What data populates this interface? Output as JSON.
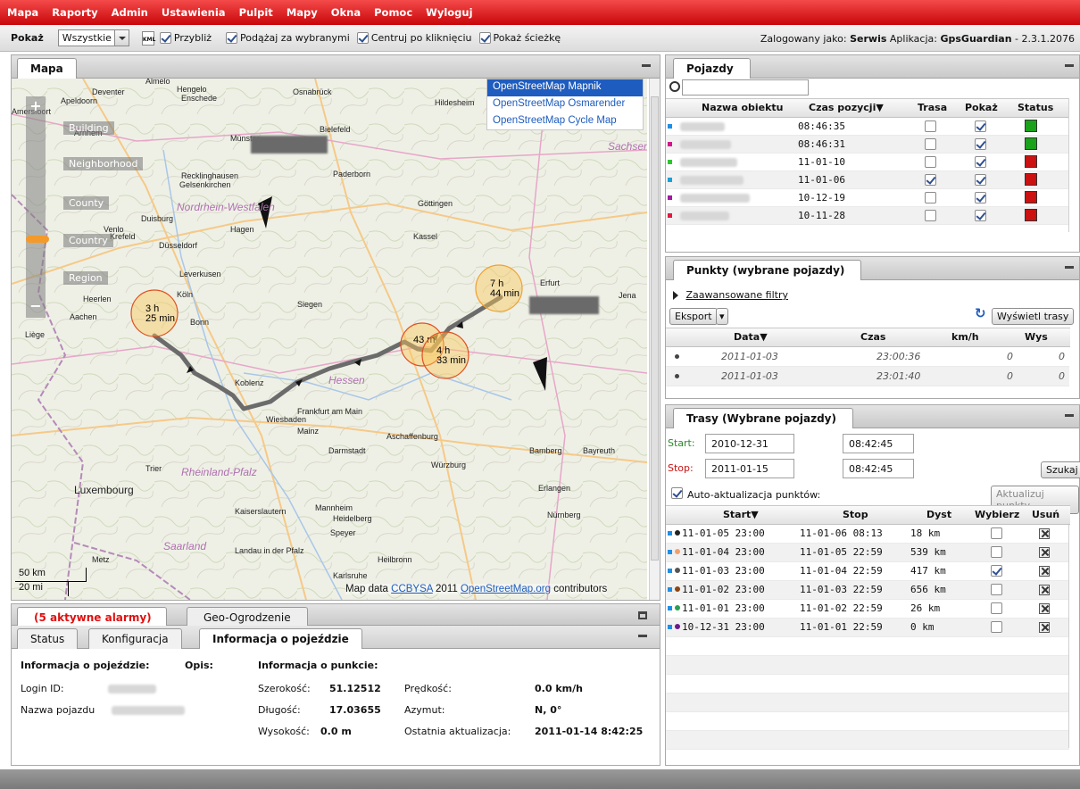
{
  "menu": [
    "Mapa",
    "Raporty",
    "Admin",
    "Ustawienia",
    "Pulpit",
    "Mapy",
    "Okna",
    "Pomoc",
    "Wyloguj"
  ],
  "toolbar": {
    "show_label": "Pokaż",
    "show_value": "Wszystkie",
    "kml_label": "KML",
    "zoom_label": "Przybliż",
    "follow_label": "Podążaj za wybranymi",
    "center_label": "Centruj po kliknięciu",
    "path_label": "Pokaż ścieżkę",
    "logged_prefix": "Zalogowany jako:",
    "user": "Serwis",
    "app_prefix": "Aplikacja:",
    "app": "GpsGuardian",
    "version": "- 2.3.1.2076"
  },
  "map": {
    "tab": "Mapa",
    "layers": [
      "OpenStreetMap Mapnik",
      "OpenStreetMap Osmarender",
      "OpenStreetMap Cycle Map"
    ],
    "zoom_labels": [
      "Building",
      "Neighborhood",
      "County",
      "Country",
      "Region"
    ],
    "scale_km": "50 km",
    "scale_mi": "20 mi",
    "attr_prefix": "Map data",
    "attr_link1": "CCBYSA",
    "attr_year": "2011",
    "attr_link2": "OpenStreetMap.org",
    "attr_suffix": "contributors",
    "cities": [
      "Almelo",
      "Deventer",
      "Hengelo",
      "Apeldoorn",
      "Enschede",
      "Osnabrück",
      "Amersfoort",
      "Arnhem",
      "Bielefeld",
      "Hildesheim",
      "Sachsen",
      "Münster",
      "Paderborn",
      "Recklinghausen",
      "Gelsenkirchen",
      "Nordrhein-Westfalen",
      "Göttingen",
      "Duisburg",
      "Hagen",
      "Venlo",
      "Krefeld",
      "Düsseldorf",
      "Kassel",
      "Leverkusen",
      "Köln",
      "Erfurt",
      "Jena",
      "Heerlen",
      "Aachen",
      "Siegen",
      "Bonn",
      "Liège",
      "Koblenz",
      "Hessen",
      "Frankfurt am Main",
      "Wiesbaden",
      "Mainz",
      "Aschaffenburg",
      "Darmstadt",
      "Bamberg",
      "Bayreuth",
      "Trier",
      "Rheinland-Pfalz",
      "Würzburg",
      "Luxembourg",
      "Erlangen",
      "Kaiserslautern",
      "Mannheim",
      "Heidelberg",
      "Nürnberg",
      "Speyer",
      "Saarland",
      "Landau in der Pfalz",
      "Metz",
      "Heilbronn",
      "Karlsruhe"
    ],
    "stops": [
      {
        "line1": "3 h",
        "line2": "25 min"
      },
      {
        "line1": "7 h",
        "line2": "44 min"
      },
      {
        "line1": "43 m",
        "line2": ""
      },
      {
        "line1": "4 h",
        "line2": "33 min"
      }
    ]
  },
  "vehicles": {
    "tab": "Pojazdy",
    "columns": [
      "Nazwa obiektu",
      "Czas pozycji▼",
      "Trasa",
      "Pokaż",
      "Status"
    ],
    "rows": [
      {
        "color": "#1e8fe6",
        "time": "08:46:35",
        "trasa": false,
        "show": true,
        "status": "#1aa21a"
      },
      {
        "color": "#d4148a",
        "time": "08:46:31",
        "trasa": false,
        "show": true,
        "status": "#1aa21a"
      },
      {
        "color": "#2ec52e",
        "time": "11-01-10",
        "trasa": false,
        "show": true,
        "status": "#cc1111"
      },
      {
        "color": "#1aa0d8",
        "time": "11-01-06",
        "trasa": true,
        "show": true,
        "status": "#cc1111"
      },
      {
        "color": "#a01aa0",
        "time": "10-12-19",
        "trasa": false,
        "show": true,
        "status": "#cc1111"
      },
      {
        "color": "#e01a40",
        "time": "10-11-28",
        "trasa": false,
        "show": true,
        "status": "#cc1111"
      }
    ]
  },
  "points": {
    "tab": "Punkty (wybrane pojazdy)",
    "filters": "Zaawansowane filtry",
    "export": "Eksport",
    "show_routes": "Wyświetl trasy",
    "columns": [
      "Data▼",
      "Czas",
      "km/h",
      "Wys"
    ],
    "rows": [
      {
        "date": "2011-01-03",
        "time": "23:00:36",
        "speed": "0",
        "alt": "0"
      },
      {
        "date": "2011-01-03",
        "time": "23:01:40",
        "speed": "0",
        "alt": "0"
      }
    ]
  },
  "routes": {
    "tab": "Trasy (Wybrane pojazdy)",
    "start_label": "Start:",
    "start_date": "2010-12-31",
    "start_time": "08:42:45",
    "stop_label": "Stop:",
    "stop_date": "2011-01-15",
    "stop_time": "08:42:45",
    "search": "Szukaj",
    "auto_label": "Auto-aktualizacja punktów:",
    "update": "Aktualizuj punkty",
    "columns": [
      "Start▼",
      "Stop",
      "Dyst",
      "Wybierz",
      "Usuń"
    ],
    "rows": [
      {
        "dot": "#222222",
        "start": "11-01-05 23:00",
        "stop": "11-01-06 08:13",
        "dist": "18 km",
        "sel": false
      },
      {
        "dot": "#f0a070",
        "start": "11-01-04 23:00",
        "stop": "11-01-05 22:59",
        "dist": "539 km",
        "sel": false
      },
      {
        "dot": "#555555",
        "start": "11-01-03 23:00",
        "stop": "11-01-04 22:59",
        "dist": "417 km",
        "sel": true
      },
      {
        "dot": "#8b4513",
        "start": "11-01-02 23:00",
        "stop": "11-01-03 22:59",
        "dist": "656 km",
        "sel": false
      },
      {
        "dot": "#2aa050",
        "start": "11-01-01 23:00",
        "stop": "11-01-02 22:59",
        "dist": "26 km",
        "sel": false
      },
      {
        "dot": "#6a1a8a",
        "start": "10-12-31 23:00",
        "stop": "11-01-01 22:59",
        "dist": "0 km",
        "sel": false
      }
    ]
  },
  "bottom": {
    "tab_alarms": "(5 aktywne alarmy)",
    "tab_geo": "Geo-Ogrodzenie",
    "tab_status": "Status",
    "tab_config": "Konfiguracja",
    "tab_info": "Informacja o pojeździe",
    "h_vehicle": "Informacja o pojeździe:",
    "h_desc": "Opis:",
    "h_point": "Informacja o punkcie:",
    "login_label": "Login ID:",
    "name_label": "Nazwa pojazdu",
    "lat_label": "Szerokość:",
    "lat": "51.12512",
    "lon_label": "Długość:",
    "lon": "17.03655",
    "alt_label": "Wysokość:",
    "alt": "0.0 m",
    "speed_label": "Prędkość:",
    "speed": "0.0 km/h",
    "azimuth_label": "Azymut:",
    "azimuth": "N, 0°",
    "update_label": "Ostatnia aktualizacja:",
    "update": "2011-01-14 8:42:25"
  }
}
